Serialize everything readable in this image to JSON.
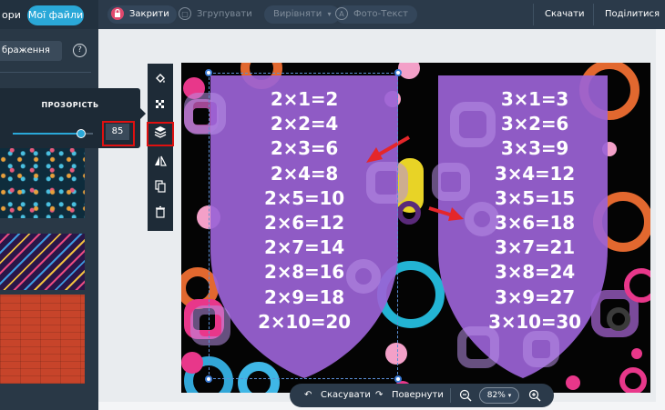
{
  "header": {
    "prev_tab_label": "ори",
    "files_tab_label": "Мої файли",
    "close_label": "Закрити",
    "group_label": "Згрупувати",
    "align_label": "Вирівняти",
    "align_caret": "▾",
    "phototext_label": "Фото-Текст",
    "download_label": "Скачати",
    "share_label": "Поділитися"
  },
  "sidebar": {
    "search_text": "браження",
    "help_glyph": "?"
  },
  "opacity_popup": {
    "title": "ПРОЗОРІСТЬ",
    "value": "85",
    "fraction": 0.85
  },
  "tools": [
    {
      "icon": "fill-bucket-icon"
    },
    {
      "icon": "transparency-icon"
    },
    {
      "icon": "layers-icon"
    },
    {
      "icon": "flip-icon"
    },
    {
      "icon": "copy-icon"
    },
    {
      "icon": "trash-icon"
    }
  ],
  "canvas": {
    "left_table": [
      "2×1=2",
      "2×2=4",
      "2×3=6",
      "2×4=8",
      "2×5=10",
      "2×6=12",
      "2×7=14",
      "2×8=16",
      "2×9=18",
      "2×10=20"
    ],
    "right_table": [
      "3×1=3",
      "3×2=6",
      "3×3=9",
      "3×4=12",
      "3×5=15",
      "3×6=18",
      "3×7=21",
      "3×8=24",
      "3×9=27",
      "3×10=30"
    ],
    "shield_color": "#9b63d6",
    "background_color": "#040404",
    "arrow_color": "#e5262a"
  },
  "bottom_bar": {
    "undo_label": "Скасувати",
    "redo_label": "Повернути",
    "zoom_value": "82%",
    "zoom_caret": "▾"
  }
}
